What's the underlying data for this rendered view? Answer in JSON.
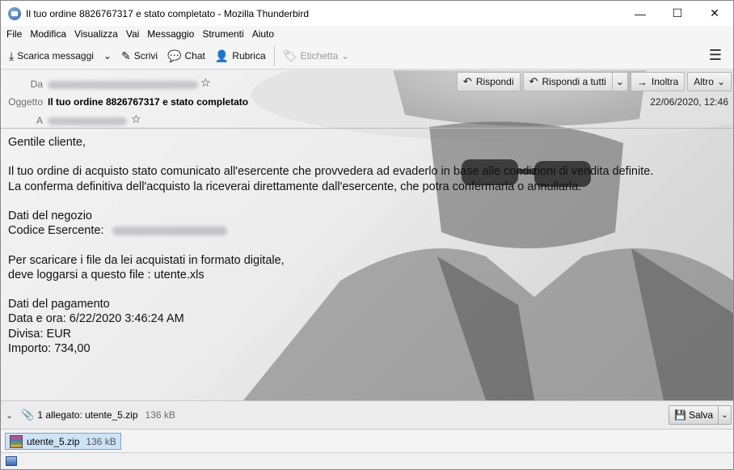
{
  "window": {
    "title": "Il tuo ordine 8826767317 e stato completato - Mozilla Thunderbird",
    "controls": {
      "minimize": "—",
      "maximize": "☐",
      "close": "✕"
    }
  },
  "menu": [
    "File",
    "Modifica",
    "Visualizza",
    "Vai",
    "Messaggio",
    "Strumenti",
    "Aiuto"
  ],
  "toolbar": {
    "get_messages": "Scarica messaggi",
    "write": "Scrivi",
    "chat": "Chat",
    "address_book": "Rubrica",
    "tag": "Etichetta"
  },
  "header": {
    "from_label": "Da",
    "subject_label": "Oggetto",
    "subject": "Il tuo ordine 8826767317 e stato completato",
    "to_label": "A",
    "date": "22/06/2020, 12:46",
    "reply": "Rispondi",
    "reply_all": "Rispondi a tutti",
    "forward": "Inoltra",
    "more": "Altro"
  },
  "body": {
    "greeting": "Gentile cliente,",
    "para1_line1": "Il tuo ordine di acquisto stato comunicato all'esercente che provvedera ad evaderlo in base alle condizioni di vendita definite.",
    "para1_line2": "La conferma definitiva dell'acquisto la riceverai direttamente dall'esercente, che potra confermarla o annullarla.",
    "shop_title": "Dati del negozio",
    "merchant_code_label": "Codice Esercente:",
    "download_line1": "Per scaricare i file da lei acquistati in formato digitale,",
    "download_line2": "deve loggarsi a questo file : utente.xls",
    "payment_title": "Dati del pagamento",
    "datetime": "Data e ora: 6/22/2020 3:46:24 AM",
    "currency": "Divisa: EUR",
    "amount": "Importo: 734,00"
  },
  "attachments": {
    "summary": "1 allegato: utente_5.zip",
    "summary_size": "136 kB",
    "save": "Salva",
    "items": [
      {
        "name": "utente_5.zip",
        "size": "136 kB"
      }
    ]
  },
  "colors": {
    "accent": "#cde4f7",
    "accent_border": "#7da2ce"
  }
}
